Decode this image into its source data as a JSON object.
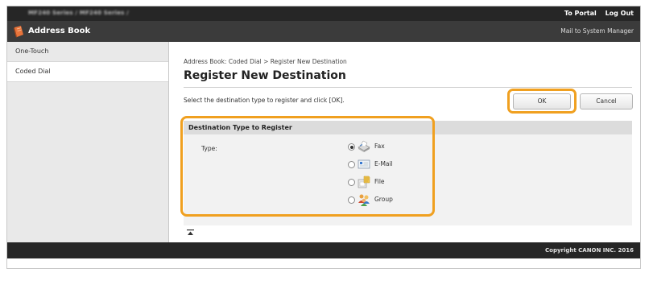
{
  "topbar": {
    "device_text": "MF240 Series / MF240 Series /",
    "links": {
      "portal": "To Portal",
      "logout": "Log Out"
    }
  },
  "titlebar": {
    "title": "Address Book",
    "mail_link": "Mail to System Manager"
  },
  "sidebar": {
    "items": [
      {
        "label": "One-Touch",
        "active": false
      },
      {
        "label": "Coded Dial",
        "active": true
      }
    ]
  },
  "main": {
    "breadcrumb": "Address Book: Coded Dial > Register New Destination",
    "page_title": "Register New Destination",
    "instruction": "Select the destination type to register and click [OK].",
    "buttons": {
      "ok": "OK",
      "cancel": "Cancel"
    },
    "section": {
      "header": "Destination Type to Register",
      "type_label": "Type:",
      "options": [
        {
          "label": "Fax",
          "icon": "fax-icon",
          "selected": true
        },
        {
          "label": "E-Mail",
          "icon": "email-icon",
          "selected": false
        },
        {
          "label": "File",
          "icon": "file-icon",
          "selected": false
        },
        {
          "label": "Group",
          "icon": "group-icon",
          "selected": false
        }
      ]
    },
    "back_to_top_icon": "back-to-top-icon"
  },
  "footer": {
    "copyright": "Copyright CANON INC. 2016"
  },
  "colors": {
    "highlight": "#f0a020",
    "header_dark": "#262626",
    "title_bar": "#3b3b3b"
  }
}
